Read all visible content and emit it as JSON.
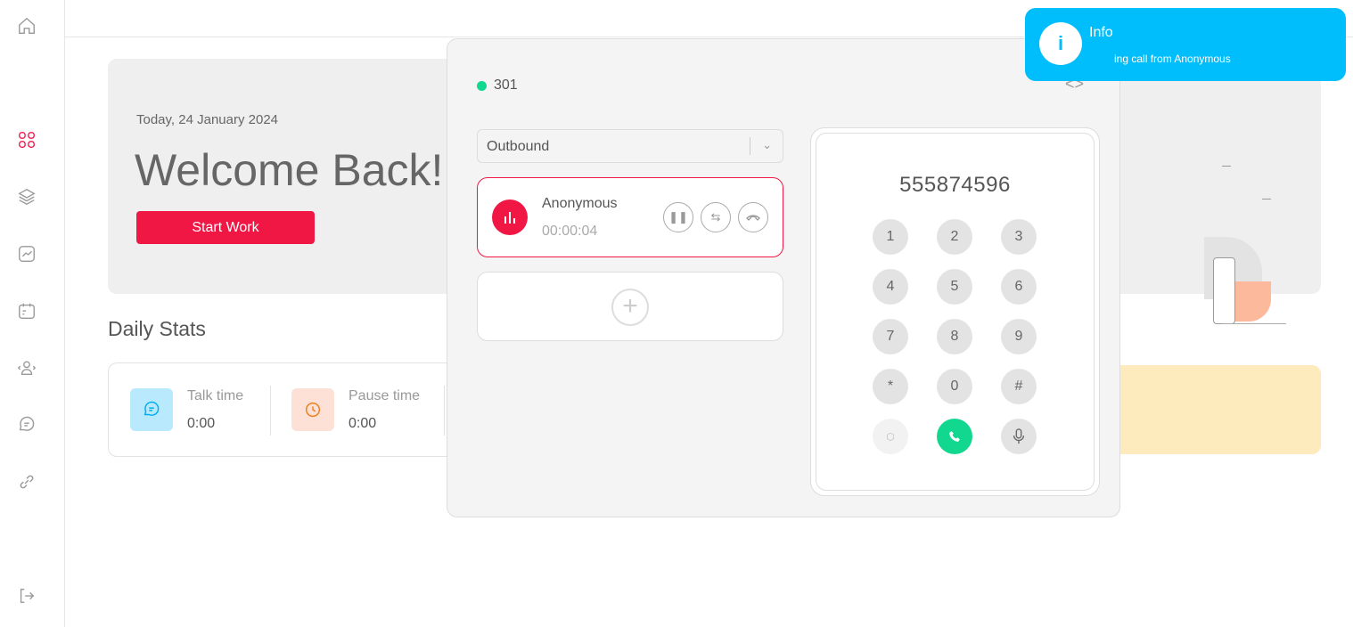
{
  "sidebar": {
    "items": [
      {
        "name": "home-icon"
      },
      {
        "name": "dashboard-icon",
        "active": true
      },
      {
        "name": "layers-icon"
      },
      {
        "name": "chart-icon"
      },
      {
        "name": "calendar-icon"
      },
      {
        "name": "users-icon"
      },
      {
        "name": "chat-icon"
      },
      {
        "name": "link-icon"
      },
      {
        "name": "logout-icon"
      }
    ]
  },
  "hero": {
    "date": "Today, 24 January 2024",
    "title": "Welcome Back!",
    "start_button": "Start Work"
  },
  "stats": {
    "title": "Daily Stats",
    "items": [
      {
        "label": "Talk time",
        "value": "0:00",
        "icon": "chat-icon",
        "color": "#00aef0"
      },
      {
        "label": "Pause time",
        "value": "0:00",
        "icon": "clock-icon",
        "color": "#f07f1e"
      }
    ]
  },
  "phone": {
    "extension": "301",
    "status_color": "#12d88f",
    "direction": "Outbound",
    "call": {
      "name": "Anonymous",
      "duration": "00:00:04"
    },
    "dialed_number": "555874596",
    "keys": [
      "1",
      "2",
      "3",
      "4",
      "5",
      "6",
      "7",
      "8",
      "9",
      "*",
      "0",
      "#"
    ]
  },
  "toast": {
    "title": "Info",
    "message": "ing call from Anonymous",
    "color": "#00bdfc"
  },
  "colors": {
    "accent": "#f01745",
    "call_green": "#12d88f"
  }
}
